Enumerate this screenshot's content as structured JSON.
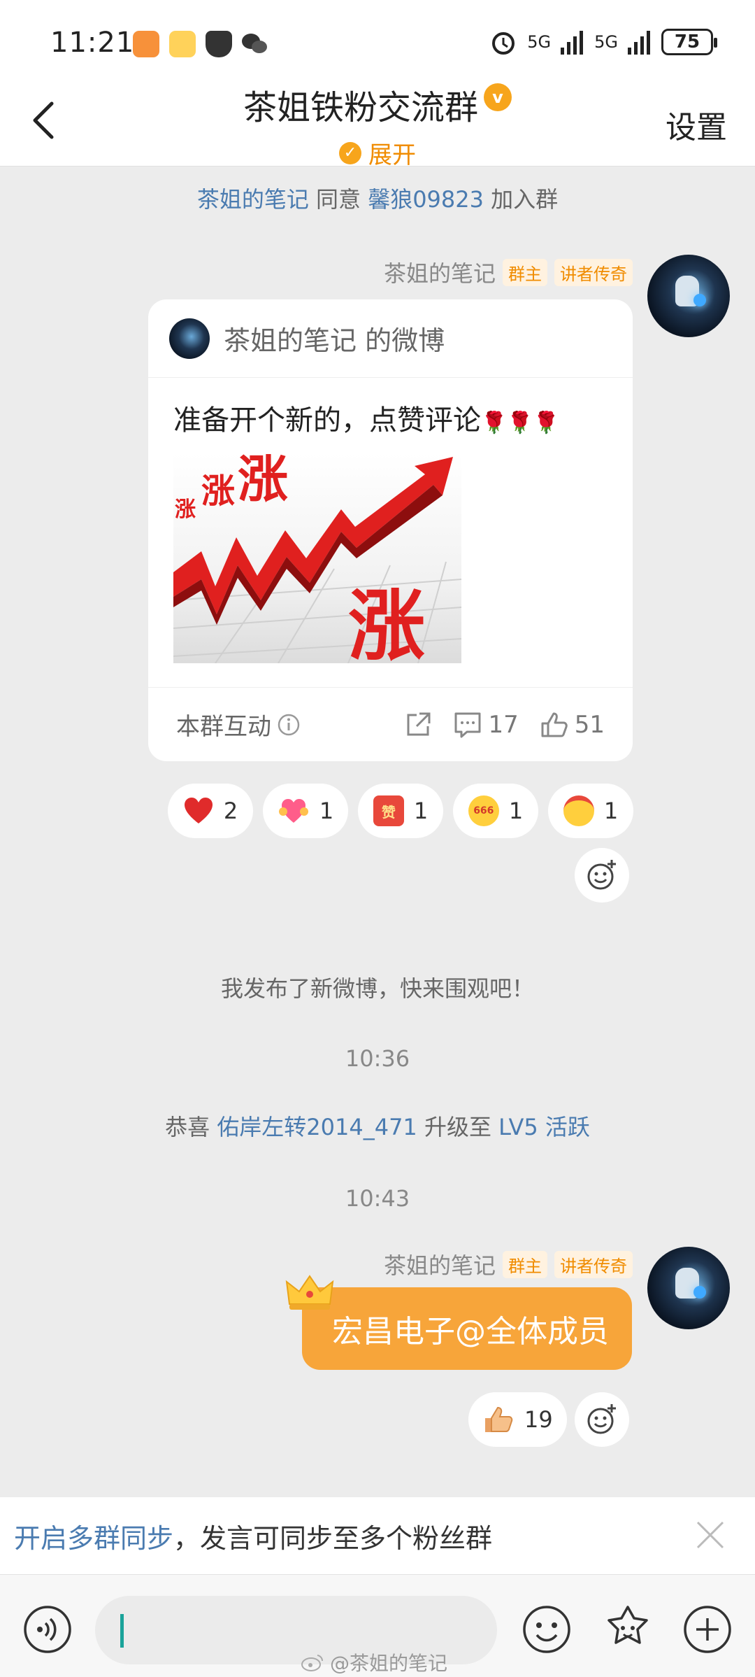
{
  "status_bar": {
    "time": "11:21",
    "signal_1": "5G",
    "signal_2": "5G",
    "battery": "75"
  },
  "header": {
    "title": "茶姐铁粉交流群",
    "expand_label": "展开",
    "settings_label": "设置"
  },
  "messages": {
    "sys_join": {
      "actor": "茶姐的笔记",
      "verb": "同意",
      "target": "馨狼09823",
      "suffix": "加入群"
    },
    "sender_name": "茶姐的笔记",
    "tag_owner": "群主",
    "tag_speaker": "讲者传奇",
    "card": {
      "header": "茶姐的笔记 的微博",
      "text": "准备开个新的，点赞评论",
      "roses": "🌹🌹🌹",
      "image_words": [
        "涨",
        "涨",
        "涨",
        "涨"
      ],
      "footer_label": "本群互动",
      "comments": "17",
      "likes": "51"
    },
    "reactions": [
      {
        "icon": "heart-icon",
        "count": "2"
      },
      {
        "icon": "heart-hug-icon",
        "count": "1"
      },
      {
        "icon": "zan-stamp-icon",
        "count": "1"
      },
      {
        "icon": "666-face-icon",
        "count": "1"
      },
      {
        "icon": "headband-face-icon",
        "count": "1"
      }
    ],
    "sys_new_post": "我发布了新微博，快来围观吧！",
    "time_1": "10:36",
    "sys_upgrade": {
      "prefix": "恭喜",
      "user": "佑岸左转2014_471",
      "mid": "升级至",
      "level": "LV5 活跃"
    },
    "time_2": "10:43",
    "bubble_text": "宏昌电子@全体成员",
    "bubble_reaction": {
      "icon": "thumbs-up-icon",
      "count": "19"
    }
  },
  "sync_banner": {
    "link": "开启多群同步",
    "text": "，发言可同步至多个粉丝群"
  },
  "watermark": "@茶姐的笔记",
  "colors": {
    "accent_orange": "#f7a53a",
    "link_blue": "#4a7bb0",
    "chart_red": "#e0201f"
  }
}
